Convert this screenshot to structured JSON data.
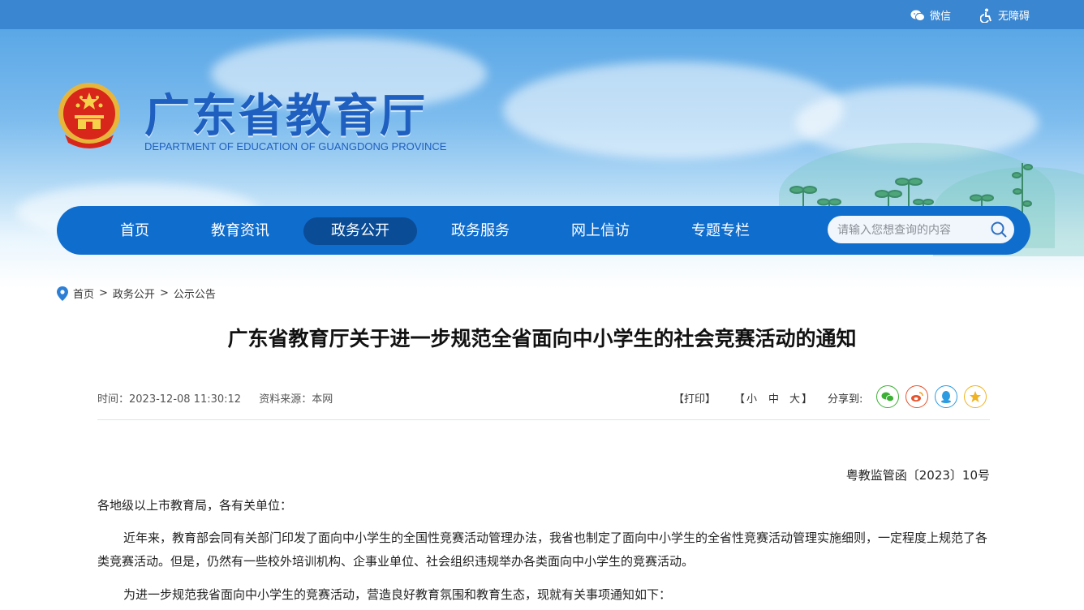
{
  "topbar": {
    "wechat_label": "微信",
    "accessibility_label": "无障碍"
  },
  "header": {
    "title": "广东省教育厅",
    "subtitle": "DEPARTMENT OF EDUCATION OF GUANGDONG PROVINCE"
  },
  "nav": {
    "items": [
      {
        "label": "首页"
      },
      {
        "label": "教育资讯"
      },
      {
        "label": "政务公开"
      },
      {
        "label": "政务服务"
      },
      {
        "label": "网上信访"
      },
      {
        "label": "专题专栏"
      }
    ],
    "active": "政务公开",
    "search_placeholder": "请输入您想查询的内容"
  },
  "breadcrumb": {
    "home": "首页",
    "sep": ">",
    "level1": "政务公开",
    "level2": "公示公告"
  },
  "article": {
    "title": "广东省教育厅关于进一步规范全省面向中小学生的社会竞赛活动的通知",
    "time_label": "时间：2023-12-08 11:30:12",
    "source_label": "资料来源：本网",
    "print_label": "【打印】",
    "size_open": "【",
    "size_small": "小",
    "size_medium": "中",
    "size_large": "大",
    "size_close": "】",
    "share_label": "分享到:",
    "doc_number": "粤教监管函〔2023〕10号",
    "salutation": "各地级以上市教育局，各有关单位：",
    "para1": "近年来，教育部会同有关部门印发了面向中小学生的全国性竞赛活动管理办法，我省也制定了面向中小学生的全省性竞赛活动管理实施细则，一定程度上规范了各类竞赛活动。但是，仍然有一些校外培训机构、企事业单位、社会组织违规举办各类面向中小学生的竞赛活动。",
    "para2": "为进一步规范我省面向中小学生的竞赛活动，营造良好教育氛围和教育生态，现就有关事项通知如下："
  },
  "colors": {
    "nav_bg": "#0f6dce",
    "nav_active": "#0b4c97",
    "title_blue": "#1f5fbf",
    "wechat": "#3cb035",
    "weibo": "#e6532d",
    "qq": "#2d9be0",
    "qzone": "#f0b323"
  },
  "icons": [
    "wechat-icon",
    "accessibility-icon",
    "national-emblem",
    "search-icon",
    "location-pin-icon",
    "share-wechat-icon",
    "share-weibo-icon",
    "share-qq-icon",
    "share-qzone-icon"
  ]
}
